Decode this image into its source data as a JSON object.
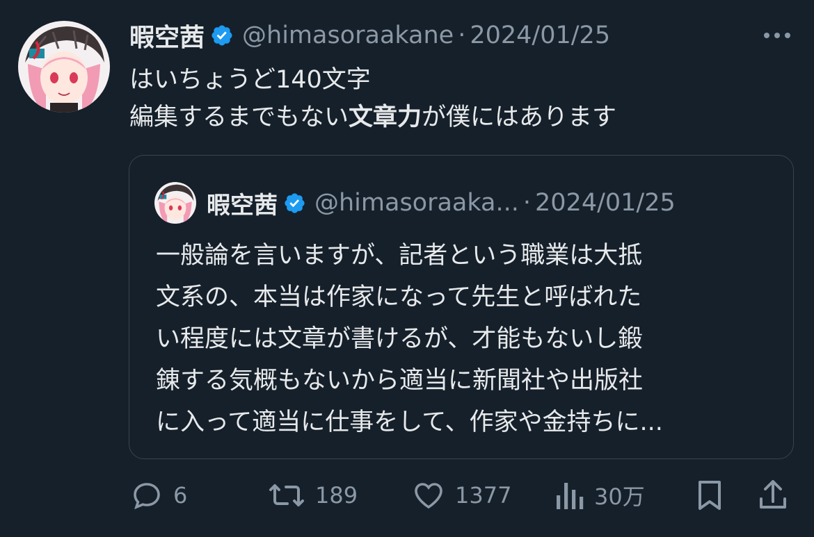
{
  "tweet": {
    "display_name": "暇空茜",
    "handle": "@himasoraakane",
    "separator": "·",
    "date": "2024/01/25",
    "text_line1": "はいちょうど140文字",
    "text_line2_a": "編集するまでもない",
    "text_line2_bold": "文章力",
    "text_line2_b": "が僕にはあります"
  },
  "quoted": {
    "display_name": "暇空茜",
    "handle": "@himasoraaka...",
    "separator": "·",
    "date": "2024/01/25",
    "lines": [
      "一般論を言いますが、記者という職業は大抵",
      "文系の、本当は作家になって先生と呼ばれた",
      "い程度には文章が書けるが、才能もないし鍛",
      "錬する気概もないから適当に新聞社や出版社",
      "に入って適当に仕事をして、作家や金持ちに..."
    ]
  },
  "actions": {
    "replies": "6",
    "retweets": "189",
    "likes": "1377",
    "views": "30万"
  },
  "colors": {
    "background": "#15202b",
    "text": "#e7e9ea",
    "muted": "#8b98a5",
    "verified": "#1d9bf0",
    "border": "#38444d"
  },
  "icons": [
    "avatar-image",
    "verified-badge-icon",
    "more-options-icon",
    "reply-icon",
    "retweet-icon",
    "like-icon",
    "views-icon",
    "bookmark-icon",
    "share-icon"
  ]
}
